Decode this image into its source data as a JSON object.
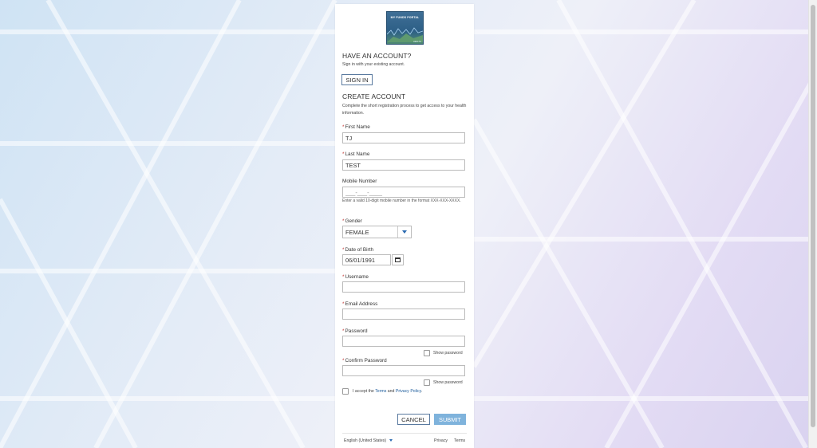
{
  "logo": {
    "title": "MY FUNDS PORTAL",
    "sub": "HEALTH"
  },
  "signin": {
    "heading": "HAVE AN ACCOUNT?",
    "subtext": "Sign in with your existing account.",
    "button": "SIGN IN"
  },
  "create": {
    "heading": "CREATE ACCOUNT",
    "subtext": "Complete the short registration process to get access to your health information."
  },
  "fields": {
    "required_marker": "*",
    "first_name": {
      "label": "First Name",
      "value": "TJ"
    },
    "last_name": {
      "label": "Last Name",
      "value": "TEST"
    },
    "mobile": {
      "label": "Mobile Number",
      "placeholder": "___-___-____",
      "hint": "Enter a valid 10-digit mobile number in the format XXX-XXX-XXXX."
    },
    "gender": {
      "label": "Gender",
      "value": "FEMALE"
    },
    "dob": {
      "label": "Date of Birth",
      "value": "06/01/1991"
    },
    "username": {
      "label": "Username",
      "value": ""
    },
    "email": {
      "label": "Email Address",
      "value": ""
    },
    "password": {
      "label": "Password",
      "value": "",
      "show_label": "Show password"
    },
    "confirm_password": {
      "label": "Confirm Password",
      "value": "",
      "show_label": "Show password"
    }
  },
  "terms": {
    "prefix": "I accept the",
    "terms_link": "Terms",
    "and": "and",
    "privacy_link": "Privacy Policy",
    "suffix": "."
  },
  "actions": {
    "cancel": "CANCEL",
    "submit": "SUBMIT"
  },
  "footer": {
    "language": "English (United States)",
    "privacy": "Privacy",
    "terms": "Terms"
  },
  "colors": {
    "accent": "#2a6ab0",
    "submit_bg": "#7fb3dc",
    "required": "#c23934"
  }
}
